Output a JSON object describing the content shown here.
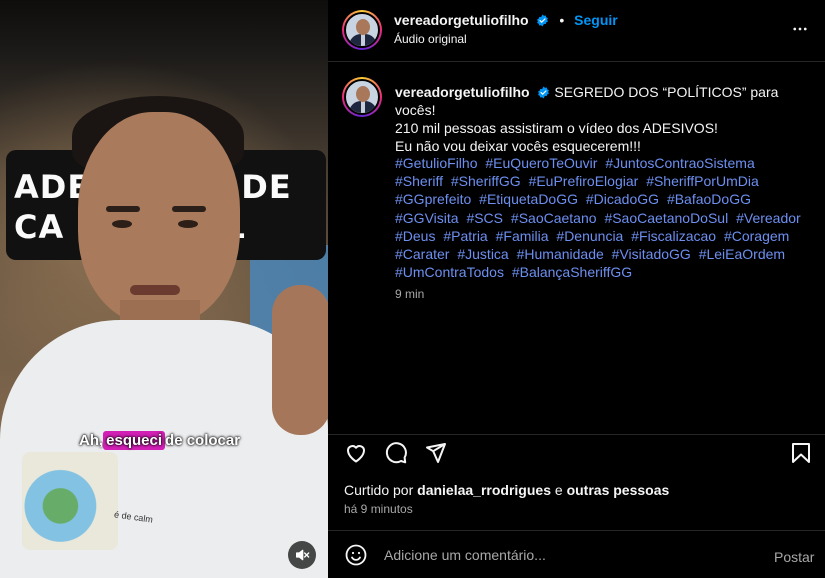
{
  "video": {
    "sign_line_1": "ADE       ÃO DE",
    "sign_line_2": "CA        CIAL",
    "caption_before": "Ah,",
    "caption_highlight": "esqueci",
    "caption_after": "de colocar",
    "print_text": "é de calm",
    "mute_icon": "muted-speaker-icon"
  },
  "header": {
    "username": "vereadorgetuliofilho",
    "follow_label": "Seguir",
    "audio_label": "Áudio original",
    "more_icon": "more-horizontal-icon",
    "verified_color": "#0095f6"
  },
  "caption": {
    "username": "vereadorgetuliofilho",
    "first_line": "SEGREDO DOS “POLÍTICOS” para vocês!",
    "line_2": "210 mil pessoas assistiram o vídeo dos ADESIVOS!",
    "line_3": "Eu não vou deixar vocês esquecerem!!!",
    "hashtags": [
      "#GetulioFilho",
      "#EuQueroTeOuvir",
      "#JuntosContraoSistema",
      "#Sheriff",
      "#SheriffGG",
      "#EuPrefiroElogiar",
      "#SheriffPorUmDia",
      "#GGprefeito",
      "#EtiquetaDoGG",
      "#DicadoGG",
      "#BafaoDoGG",
      "#GGVisita",
      "#SCS",
      "#SaoCaetano",
      "#SaoCaetanoDoSul",
      "#Vereador",
      "#Deus",
      "#Patria",
      "#Familia",
      "#Denuncia",
      "#Fiscalizacao",
      "#Coragem",
      "#Carater",
      "#Justica",
      "#Humanidade",
      "#VisitadoGG",
      "#LeiEaOrdem",
      "#UmContraTodos",
      "#BalançaSheriffGG"
    ],
    "time": "9 min",
    "hashtag_color": "#6d8ff0"
  },
  "actions": {
    "like_icon": "heart-icon",
    "comment_icon": "comment-icon",
    "share_icon": "share-icon",
    "save_icon": "bookmark-icon"
  },
  "likes": {
    "prefix": "Curtido por",
    "user": "danielaa_rrodrigues",
    "middle": "e",
    "others": "outras pessoas",
    "ago": "há 9 minutos"
  },
  "comment": {
    "emoji_icon": "emoji-icon",
    "placeholder": "Adicione um comentário...",
    "post_label": "Postar"
  }
}
